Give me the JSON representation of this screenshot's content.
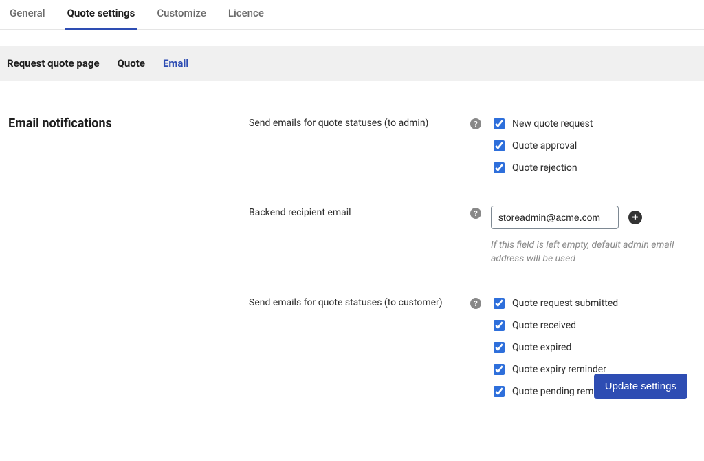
{
  "top_tabs": {
    "general": "General",
    "quote_settings": "Quote settings",
    "customize": "Customize",
    "licence": "Licence"
  },
  "sub_tabs": {
    "request_quote_page": "Request quote page",
    "quote": "Quote",
    "email": "Email"
  },
  "section": {
    "title": "Email notifications"
  },
  "fields": {
    "admin_statuses_label": "Send emails for quote statuses (to admin)",
    "backend_email_label": "Backend recipient email",
    "backend_email_value": "storeadmin@acme.com",
    "backend_email_helper": "If this field is left empty, default admin email address will be used",
    "customer_statuses_label": "Send emails for quote statuses (to customer)"
  },
  "admin_checkboxes": {
    "new_quote_request": "New quote request",
    "quote_approval": "Quote approval",
    "quote_rejection": "Quote rejection"
  },
  "customer_checkboxes": {
    "request_submitted": "Quote request submitted",
    "quote_received": "Quote received",
    "quote_expired": "Quote expired",
    "expiry_reminder": "Quote expiry reminder",
    "pending_reminder": "Quote pending reminder"
  },
  "footer": {
    "save_label": "Update settings"
  }
}
